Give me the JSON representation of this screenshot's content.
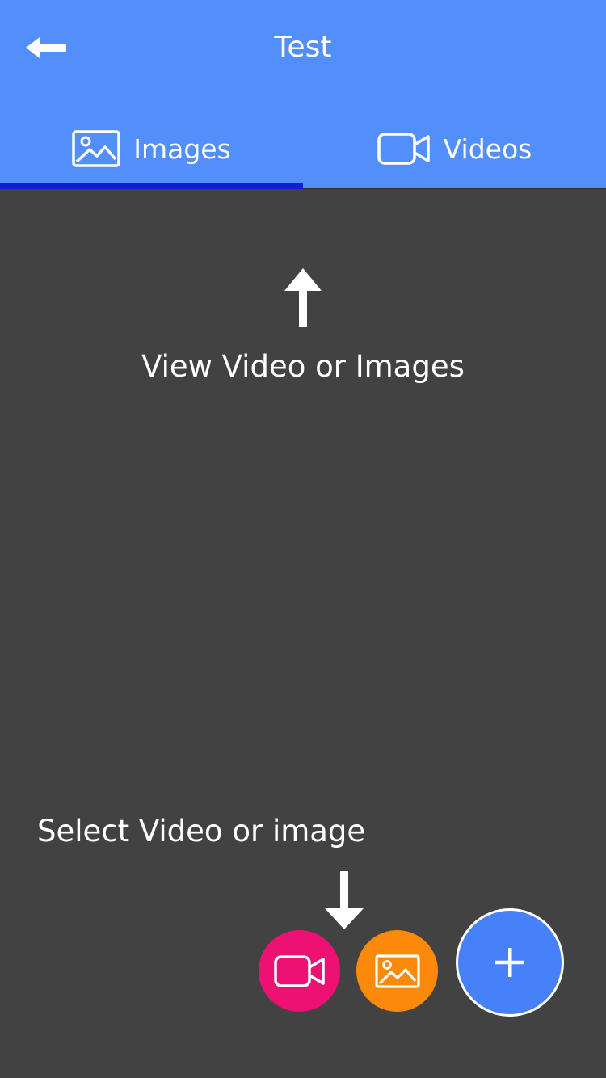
{
  "header": {
    "title": "Test",
    "back_icon": "arrow-left-icon"
  },
  "tabs": [
    {
      "label": "Images",
      "icon": "image-icon",
      "selected": true
    },
    {
      "label": "Videos",
      "icon": "video-camera-icon",
      "selected": false
    }
  ],
  "main": {
    "hint_top": "View Video or Images",
    "hint_bottom": "Select Video or image"
  },
  "fabs": {
    "video_icon": "video-camera-icon",
    "image_icon": "image-icon",
    "add_icon": "plus-icon"
  },
  "colors": {
    "header": "#528ffb",
    "tab_indicator": "#0d1ed6",
    "background": "#424242",
    "fab_video": "#ec1173",
    "fab_image": "#fb8a0b",
    "fab_add": "#4781fa"
  }
}
